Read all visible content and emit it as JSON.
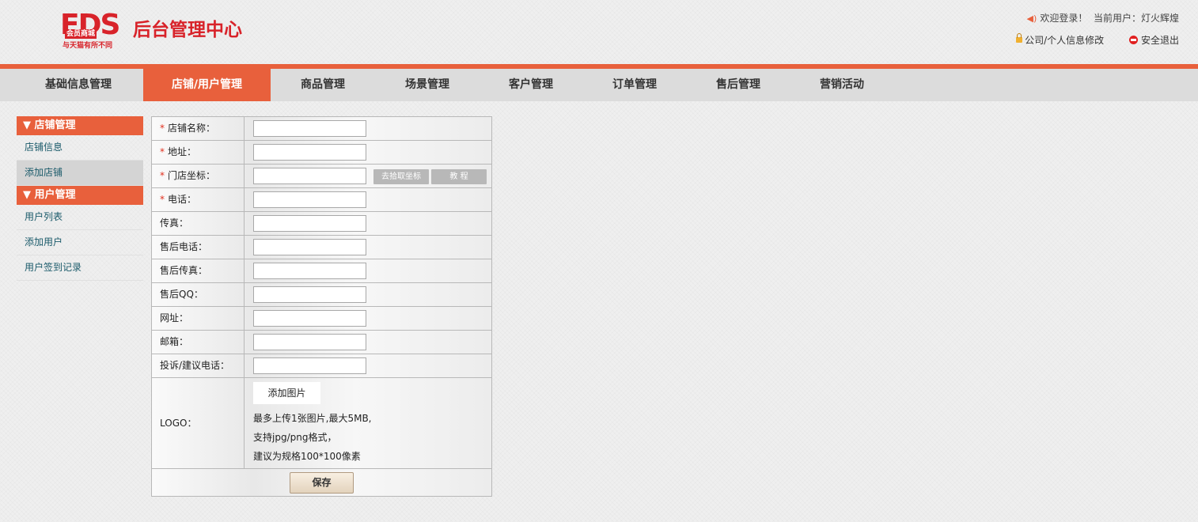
{
  "logo": {
    "mark_text": "EDS",
    "mark_subtext": "会员商城",
    "slogan": "与天猫有所不同",
    "title": "后台管理中心"
  },
  "header": {
    "welcome": "欢迎登录！",
    "current_user_label": "当前用户：",
    "current_user": "灯火辉煌",
    "profile_link": "公司/个人信息修改",
    "logout_link": "安全退出"
  },
  "nav": {
    "active_index": 1,
    "items": [
      "基础信息管理",
      "店铺/用户管理",
      "商品管理",
      "场景管理",
      "客户管理",
      "订单管理",
      "售后管理",
      "营销活动"
    ]
  },
  "sidebar": {
    "store_header": "▼ 店铺管理",
    "store_items": [
      "店铺信息",
      "添加店铺"
    ],
    "user_header": "▼ 用户管理",
    "user_items": [
      "用户列表",
      "添加用户",
      "用户签到记录"
    ]
  },
  "form": {
    "required_mark": "*",
    "fields": [
      {
        "label": "店铺名称：",
        "value": "",
        "required": true
      },
      {
        "label": "地址：",
        "value": "",
        "required": true
      },
      {
        "label": "门店坐标：",
        "value": "",
        "required": true
      },
      {
        "label": "电话：",
        "value": "",
        "required": true
      },
      {
        "label": "传真：",
        "value": "",
        "required": false
      },
      {
        "label": "售后电话：",
        "value": "",
        "required": false
      },
      {
        "label": "售后传真：",
        "value": "",
        "required": false
      },
      {
        "label": "售后QQ：",
        "value": "",
        "required": false
      },
      {
        "label": "网址：",
        "value": "",
        "required": false
      },
      {
        "label": "邮箱：",
        "value": "",
        "required": false
      },
      {
        "label": "投诉/建议电话：",
        "value": "",
        "required": false
      }
    ],
    "pick_coord_button": "去拾取坐标",
    "tutorial_button": "教 程",
    "logo_label": "LOGO：",
    "upload_button": "添加图片",
    "hints": [
      "最多上传1张图片,最大5MB,",
      "支持jpg/png格式，",
      "建议为规格100*100像素"
    ],
    "save_button": "保存"
  },
  "colors": {
    "accent": "#e8603c",
    "brand_red": "#d8232a",
    "nav_bg": "#dcdcdc",
    "link": "#1a5a6a"
  }
}
